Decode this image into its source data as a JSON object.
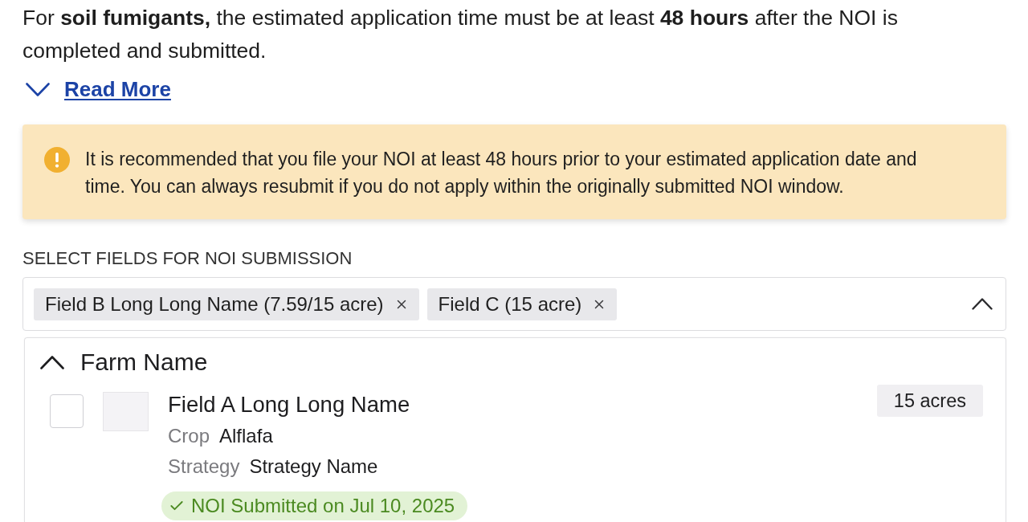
{
  "intro": {
    "text": "For **soil fumigants,** the estimated application time must be at least **48 hours** after the NOI is completed and submitted."
  },
  "read_more": {
    "label": "Read More",
    "expanded": false
  },
  "alert": {
    "kind": "warning",
    "text": "It is recommended that you file your NOI at least 48 hours prior to your estimated application date and time. You can always resubmit if you do not apply within the originally submitted NOI window."
  },
  "field_select": {
    "label": "SELECT FIELDS FOR NOI SUBMISSION",
    "expanded": true,
    "chips": [
      {
        "label": "Field B Long Long Name (7.59/15 acre)"
      },
      {
        "label": "Field C (15 acre)"
      }
    ],
    "groups": [
      {
        "name": "Farm Name",
        "expanded": true,
        "fields": [
          {
            "name": "Field A Long Long Name",
            "checked": false,
            "area": "15 acres",
            "details": [
              {
                "label": "Crop",
                "value": "Alflafa"
              },
              {
                "label": "Strategy",
                "value": "Strategy Name"
              }
            ],
            "status": {
              "kind": "submitted",
              "text": "NOI Submitted on Jul 10, 2025"
            }
          }
        ]
      }
    ]
  }
}
